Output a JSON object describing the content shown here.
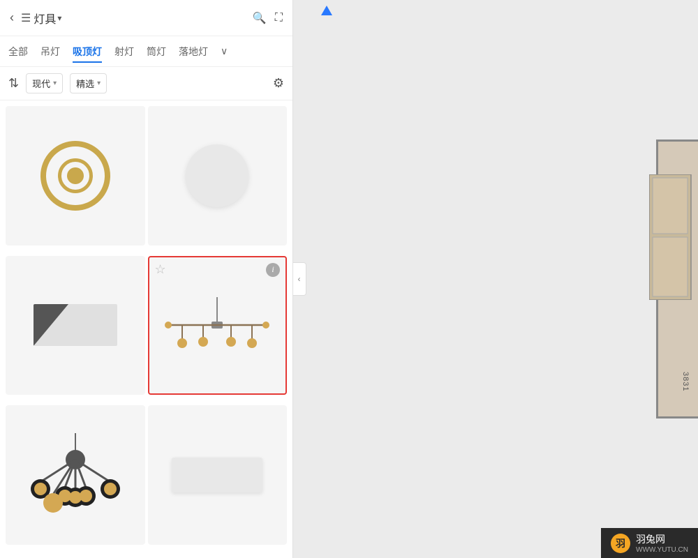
{
  "header": {
    "back_label": "‹",
    "list_icon": "☰",
    "title": "灯具",
    "dropdown_arrow": "▾",
    "search_icon": "🔍",
    "fullscreen_icon": "⛶"
  },
  "categories": {
    "items": [
      {
        "label": "全部",
        "active": false
      },
      {
        "label": "吊灯",
        "active": false
      },
      {
        "label": "吸顶灯",
        "active": true
      },
      {
        "label": "射灯",
        "active": false
      },
      {
        "label": "筒灯",
        "active": false
      },
      {
        "label": "落地灯",
        "active": false
      }
    ],
    "more_icon": "∨"
  },
  "filters": {
    "sort_icon": "⇅",
    "style_label": "现代",
    "style_arrow": "▾",
    "selection_label": "精选",
    "selection_arrow": "▾",
    "filter_icon": "⚙"
  },
  "grid_items": [
    {
      "id": 1,
      "selected": false,
      "has_star": false,
      "has_info": false,
      "type": "ring-gold"
    },
    {
      "id": 2,
      "selected": false,
      "has_star": false,
      "has_info": false,
      "type": "white-disc"
    },
    {
      "id": 3,
      "selected": false,
      "has_star": false,
      "has_info": false,
      "type": "rect-triangle"
    },
    {
      "id": 4,
      "selected": true,
      "has_star": true,
      "has_info": true,
      "type": "sputnik"
    },
    {
      "id": 5,
      "selected": false,
      "has_star": false,
      "has_info": false,
      "type": "orb-cluster"
    },
    {
      "id": 6,
      "selected": false,
      "has_star": false,
      "has_info": false,
      "type": "rect-flat"
    }
  ],
  "collapse_btn": "‹",
  "floor_plan": {
    "room_number": "3831"
  },
  "watermark": {
    "logo_text": "羽",
    "main_text": "羽兔网",
    "sub_text": "WWW.YUTU.CN"
  }
}
